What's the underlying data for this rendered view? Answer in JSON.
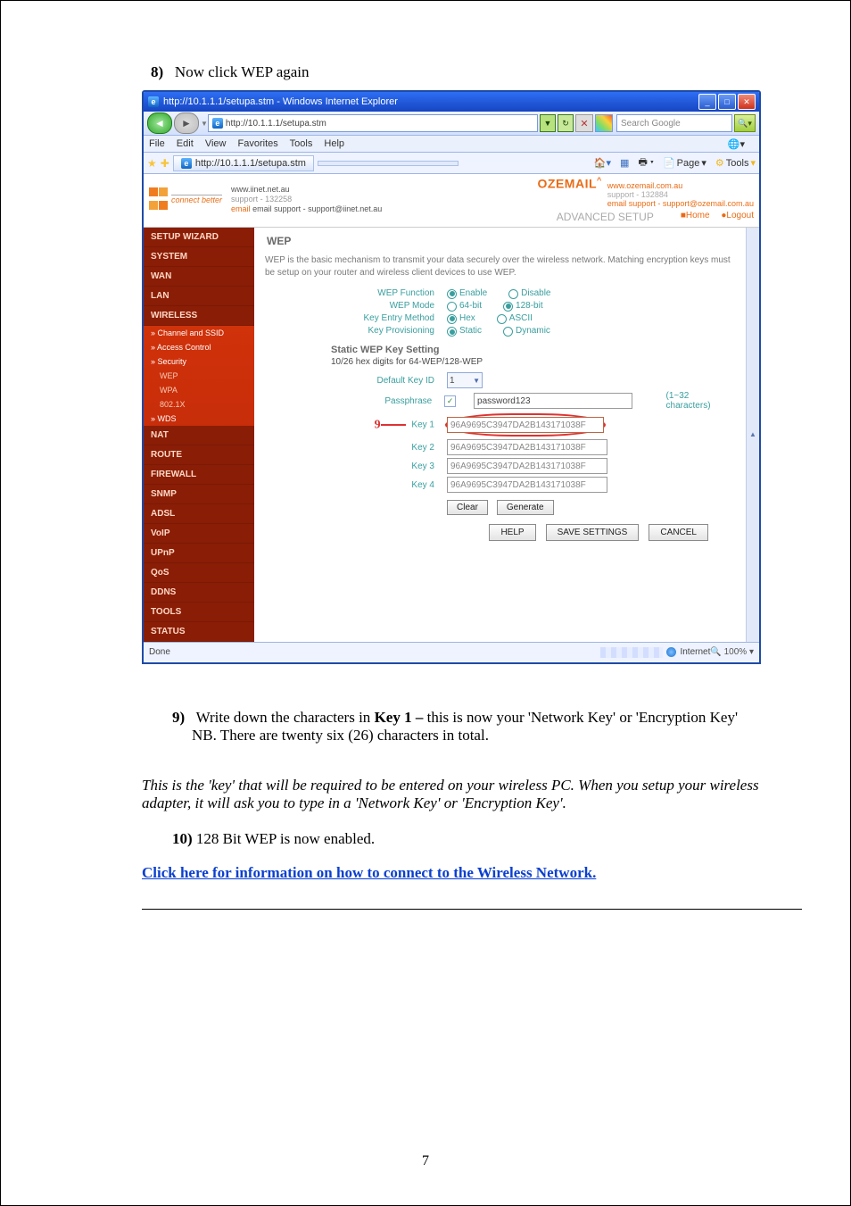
{
  "doc": {
    "step8_num": "8)",
    "step8_txt": "Now click WEP again",
    "step9_num": "9)",
    "step9_a": "Write down the characters in ",
    "step9_key": "Key 1 – ",
    "step9_b": "this is now your 'Network Key' or 'Encryption Key'",
    "step9_nb": "NB. There are twenty six (26) characters in total.",
    "ital": "This is the 'key' that will be required to be entered on your wireless PC.  When you setup your wireless adapter, it will ask you to type in a 'Network Key' or 'Encryption Key'.",
    "step10_num": "10)",
    "step10_txt": "128 Bit WEP is now enabled.",
    "linktxt": "Click here for information on how to connect to the Wireless Network.",
    "pagenum": "7"
  },
  "ie": {
    "title": "http://10.1.1.1/setupa.stm - Windows Internet Explorer",
    "addr": "http://10.1.1.1/setupa.stm",
    "search_placeholder": "Search Google",
    "menus": [
      "File",
      "Edit",
      "View",
      "Favorites",
      "Tools",
      "Help"
    ],
    "tab": "http://10.1.1.1/setupa.stm",
    "page_btn": "Page",
    "tools_btn": "Tools",
    "status_left": "Done",
    "status_zone": "Internet",
    "zoom": "100%"
  },
  "brand": {
    "iinet_url": "www.iinet.net.au",
    "iinet_sup": "support - 132258",
    "iinet_mail": "email support - support@iinet.net.au",
    "connect": "connect better",
    "ozemail": "OZEMAIL",
    "oz_url": "www.ozemail.com.au",
    "oz_sup": "support - 132884",
    "oz_mail_lbl": "email ",
    "oz_mail": "support - support@ozemail.com.au",
    "advanced": "ADVANCED SETUP",
    "home": "Home",
    "logout": "Logout"
  },
  "nav": [
    {
      "t": "hdr",
      "l": "SETUP WIZARD"
    },
    {
      "t": "hdr",
      "l": "SYSTEM"
    },
    {
      "t": "hdr",
      "l": "WAN"
    },
    {
      "t": "hdr",
      "l": "LAN"
    },
    {
      "t": "hdr",
      "l": "WIRELESS"
    },
    {
      "t": "itm",
      "l": "» Channel and SSID"
    },
    {
      "t": "itm",
      "l": "» Access Control"
    },
    {
      "t": "itm",
      "l": "» Security"
    },
    {
      "t": "sub",
      "l": "WEP"
    },
    {
      "t": "sub",
      "l": "WPA"
    },
    {
      "t": "sub",
      "l": "802.1X"
    },
    {
      "t": "itm",
      "l": "» WDS"
    },
    {
      "t": "hdr",
      "l": "NAT"
    },
    {
      "t": "hdr",
      "l": "ROUTE"
    },
    {
      "t": "hdr",
      "l": "FIREWALL"
    },
    {
      "t": "hdr",
      "l": "SNMP"
    },
    {
      "t": "hdr",
      "l": "ADSL"
    },
    {
      "t": "hdr",
      "l": "VoIP"
    },
    {
      "t": "hdr",
      "l": "UPnP"
    },
    {
      "t": "hdr",
      "l": "QoS"
    },
    {
      "t": "hdr",
      "l": "DDNS"
    },
    {
      "t": "hdr",
      "l": "TOOLS"
    },
    {
      "t": "hdr",
      "l": "STATUS"
    }
  ],
  "wep": {
    "title": "WEP",
    "desc": "WEP is the basic mechanism to transmit your data securely over the wireless network. Matching encryption keys must be setup on your router and wireless client devices to use WEP.",
    "rows": [
      {
        "lbl": "WEP Function",
        "o1": "Enable",
        "o2": "Disable",
        "sel": 1
      },
      {
        "lbl": "WEP Mode",
        "o1": "64-bit",
        "o2": "128-bit",
        "sel": 2
      },
      {
        "lbl": "Key Entry Method",
        "o1": "Hex",
        "o2": "ASCII",
        "sel": 1
      },
      {
        "lbl": "Key Provisioning",
        "o1": "Static",
        "o2": "Dynamic",
        "sel": 1
      }
    ],
    "stat_hdr": "Static WEP Key Setting",
    "hexnote": "10/26 hex digits for 64-WEP/128-WEP",
    "def_key_lbl": "Default Key ID",
    "def_key_val": "1",
    "pass_lbl": "Passphrase",
    "pass_val": "password123",
    "pass_hint": "(1~32 characters)",
    "callout": "9",
    "keys": [
      {
        "lbl": "Key 1",
        "val": "96A9695C3947DA2B143171038F"
      },
      {
        "lbl": "Key 2",
        "val": "96A9695C3947DA2B143171038F"
      },
      {
        "lbl": "Key 3",
        "val": "96A9695C3947DA2B143171038F"
      },
      {
        "lbl": "Key 4",
        "val": "96A9695C3947DA2B143171038F"
      }
    ],
    "clear": "Clear",
    "generate": "Generate",
    "help": "HELP",
    "save": "SAVE SETTINGS",
    "cancel": "CANCEL"
  }
}
